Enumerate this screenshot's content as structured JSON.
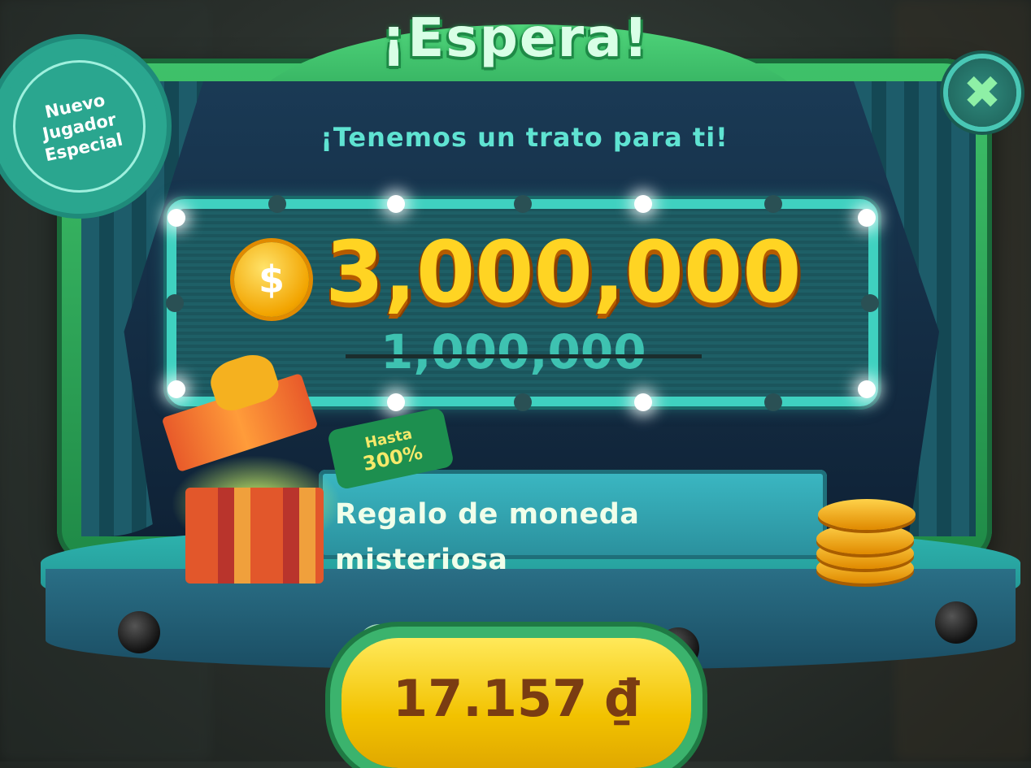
{
  "dialog": {
    "title": "¡Espera!",
    "subtitle": "¡Tenemos un trato para ti!",
    "badge_lines": [
      "Nuevo",
      "Jugador",
      "Especial"
    ],
    "close_glyph": "✖"
  },
  "offer": {
    "currency_symbol": "$",
    "amount": "3,000,000",
    "original_amount": "1,000,000"
  },
  "bonus": {
    "tag_line1": "Hasta",
    "tag_line2": "300%",
    "label": "Regalo de moneda misteriosa"
  },
  "purchase": {
    "price": "17.157 ₫"
  },
  "colors": {
    "frame_green": "#3fc26a",
    "marquee_teal": "#3fd1c0",
    "amount_gold": "#ffd423",
    "button_yellow": "#f2c200"
  },
  "icons": [
    "close-icon",
    "coin-icon",
    "gift-box-icon",
    "coin-stack-icon"
  ]
}
